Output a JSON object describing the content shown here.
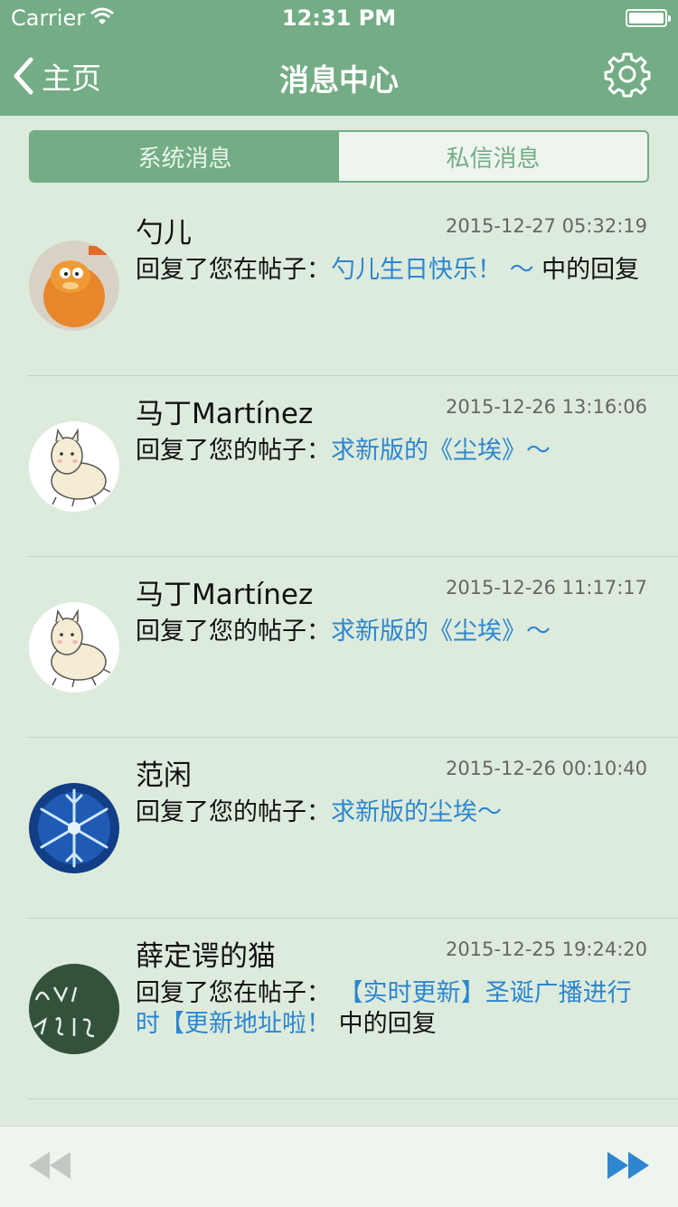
{
  "status_bar": {
    "carrier": "Carrier",
    "time": "12:31 PM"
  },
  "nav": {
    "back_label": "主页",
    "title": "消息中心"
  },
  "segments": [
    {
      "label": "系统消息",
      "active": true
    },
    {
      "label": "私信消息",
      "active": false
    }
  ],
  "messages": [
    {
      "name": "勺儿",
      "time": "2015-12-27 05:32:19",
      "prefix": "回复了您在帖子：",
      "link": "勺儿生日快乐！ ～",
      "suffix": " 中的回复",
      "avatar": "garfield-cat"
    },
    {
      "name": "马丁Martínez",
      "time": "2015-12-26 13:16:06",
      "prefix": "回复了您的帖子：",
      "link": "求新版的《尘埃》～",
      "suffix": "",
      "avatar": "alpaca"
    },
    {
      "name": "马丁Martínez",
      "time": "2015-12-26 11:17:17",
      "prefix": "回复了您的帖子：",
      "link": "求新版的《尘埃》～",
      "suffix": "",
      "avatar": "alpaca"
    },
    {
      "name": "范闲",
      "time": "2015-12-26 00:10:40",
      "prefix": "回复了您的帖子：",
      "link": "求新版的尘埃～",
      "suffix": "",
      "avatar": "snowflake"
    },
    {
      "name": "薛定谔的猫",
      "time": "2015-12-25 19:24:20",
      "prefix": "回复了您在帖子：",
      "link": " 【实时更新】圣诞广播进行时【更新地址啦！",
      "suffix": " 中的回复",
      "avatar": "chalkboard"
    }
  ],
  "colors": {
    "accent": "#73ac85",
    "link": "#2d86cf",
    "background": "#ddebdc"
  },
  "toolbar": {
    "prev_icon": "rewind-icon",
    "next_icon": "fast-forward-icon"
  }
}
